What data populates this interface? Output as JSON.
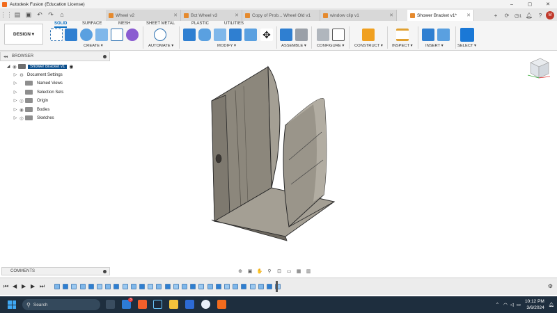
{
  "window": {
    "title": "Autodesk Fusion (Education License)",
    "min": "–",
    "max": "▢",
    "close": "✕"
  },
  "tabs": [
    {
      "label": "Wheel v2"
    },
    {
      "label": "Bct Wheel v3"
    },
    {
      "label": "Copy of Prob... Wheel Old v1"
    },
    {
      "label": "window clip v1"
    },
    {
      "label": "Shower Bracket v1*"
    }
  ],
  "header": {
    "notifications_count": "1"
  },
  "ribbon": {
    "workspace": "DESIGN ▾",
    "tabs": [
      "SOLID",
      "SURFACE",
      "MESH",
      "SHEET METAL",
      "PLASTIC",
      "UTILITIES"
    ],
    "groups": [
      "CREATE ▾",
      "AUTOMATE ▾",
      "MODIFY ▾",
      "ASSEMBLE ▾",
      "CONFIGURE ▾",
      "CONSTRUCT ▾",
      "INSPECT ▾",
      "INSERT ▾",
      "SELECT ▾"
    ]
  },
  "browser": {
    "title": "BROWSER",
    "collapse": "◂◂",
    "root": "Shower Bracket v1",
    "items": [
      {
        "label": "Document Settings"
      },
      {
        "label": "Named Views"
      },
      {
        "label": "Selection Sets"
      },
      {
        "label": "Origin"
      },
      {
        "label": "Bodies"
      },
      {
        "label": "Sketches"
      }
    ]
  },
  "comments": {
    "title": "COMMENTS"
  },
  "taskbar": {
    "search": "Search",
    "badge": "3",
    "time": "10:12 PM",
    "date": "3/6/2024"
  },
  "colors": {
    "accent": "#0a6fc2",
    "model_face": "#8c877c",
    "model_light": "#a49f94",
    "model_dark": "#6c675e"
  }
}
